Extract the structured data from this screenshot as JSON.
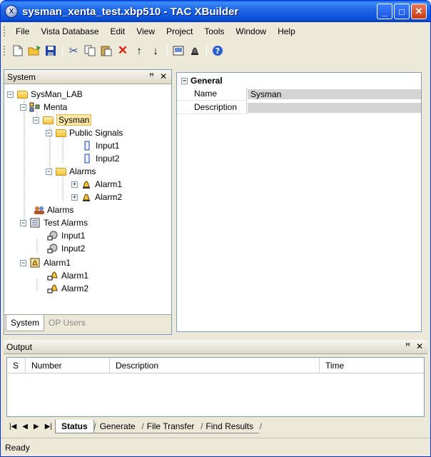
{
  "window": {
    "title": "sysman_xenta_test.xbp510 - TAC XBuilder",
    "app_icon": "X"
  },
  "menu": [
    {
      "label": "File"
    },
    {
      "label": "Vista Database"
    },
    {
      "label": "Edit"
    },
    {
      "label": "View"
    },
    {
      "label": "Project"
    },
    {
      "label": "Tools"
    },
    {
      "label": "Window"
    },
    {
      "label": "Help"
    }
  ],
  "toolbar": {
    "icons": [
      "new-icon",
      "open-icon",
      "save-icon",
      "cut-icon",
      "copy-icon",
      "paste-icon",
      "delete-icon",
      "move-up-icon",
      "move-down-icon",
      "generate-icon",
      "alarm-icon",
      "help-icon"
    ]
  },
  "system_panel": {
    "title": "System",
    "pin_glyph": "ꟸ",
    "close_glyph": "✕",
    "tabs": [
      {
        "label": "System",
        "active": true
      },
      {
        "label": "OP Users",
        "active": false
      }
    ],
    "tree": [
      {
        "label": "SysMan_LAB",
        "icon": "folder-icon"
      },
      {
        "label": "Menta",
        "icon": "menta-icon"
      },
      {
        "label": "Sysman",
        "icon": "folder-open-icon",
        "selected": true
      },
      {
        "label": "Public Signals",
        "icon": "folder-icon"
      },
      {
        "label": "Input1",
        "icon": "signal-icon"
      },
      {
        "label": "Input2",
        "icon": "signal-icon"
      },
      {
        "label": "Alarms",
        "icon": "folder-icon"
      },
      {
        "label": "Alarm1",
        "icon": "bell-icon"
      },
      {
        "label": "Alarm2",
        "icon": "bell-icon"
      },
      {
        "label": "Alarms",
        "icon": "users-icon"
      },
      {
        "label": "Test Alarms",
        "icon": "list-icon"
      },
      {
        "label": "Input1",
        "icon": "input-alarm-icon"
      },
      {
        "label": "Input2",
        "icon": "input-alarm-icon"
      },
      {
        "label": "Alarm1",
        "icon": "bell-icon"
      },
      {
        "label": "Alarm1",
        "icon": "bell-link-icon"
      },
      {
        "label": "Alarm2",
        "icon": "bell-link-icon"
      }
    ]
  },
  "properties": {
    "category": "General",
    "rows": [
      {
        "key": "Name",
        "value": "Sysman"
      },
      {
        "key": "Description",
        "value": ""
      }
    ]
  },
  "output": {
    "title": "Output",
    "columns": [
      "S",
      "Number",
      "Description",
      "Time"
    ],
    "tabs": [
      {
        "label": "Status",
        "active": true
      },
      {
        "label": "Generate",
        "active": false
      },
      {
        "label": "File Transfer",
        "active": false
      },
      {
        "label": "Find Results",
        "active": false
      }
    ]
  },
  "status": {
    "text": "Ready"
  }
}
